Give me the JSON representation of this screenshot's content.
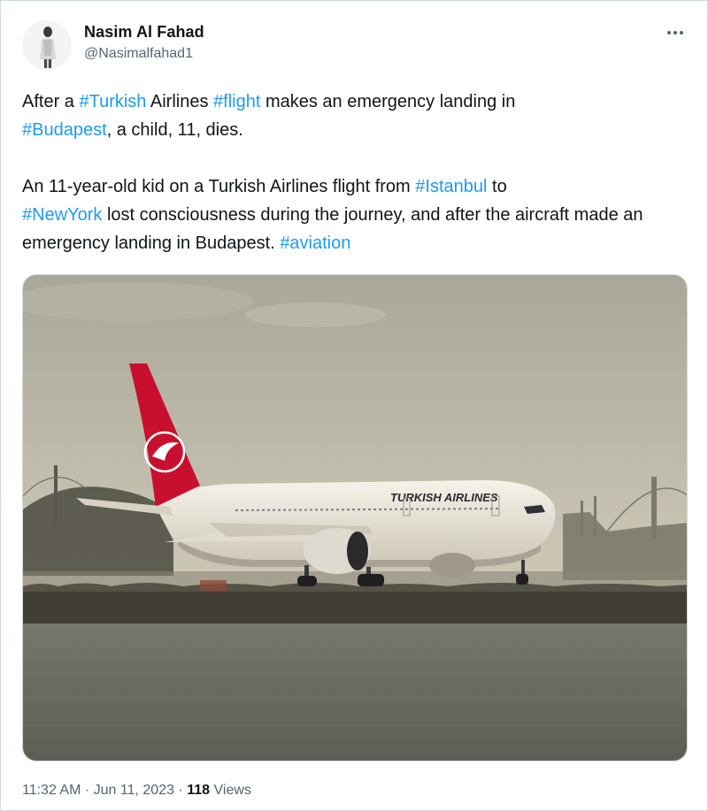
{
  "author": {
    "display_name": "Nasim Al Fahad",
    "handle": "@Nasimalfahad1"
  },
  "tweet": {
    "p1": {
      "t1": "After a ",
      "h1": "#Turkish",
      "t2": " Airlines ",
      "h2": "#flight",
      "t3": " makes an emergency landing in",
      "h3": "#Budapest",
      "t4": ", a child, 11, dies."
    },
    "p2": {
      "t1": "An 11-year-old kid on a Turkish Airlines flight from ",
      "h1": "#Istanbul",
      "t2": " to",
      "h2": "#NewYork",
      "t3": " lost consciousness during the journey, and after the aircraft made an emergency landing in Budapest. ",
      "h3": "#aviation"
    }
  },
  "media": {
    "airline_livery": "TURKISH AIRLINES"
  },
  "meta": {
    "time": "11:32 AM",
    "separator": "·",
    "date": "Jun 11, 2023",
    "views_count": "118",
    "views_label": "Views"
  },
  "icons": {
    "more": "more-dots-icon"
  },
  "colors": {
    "hashtag": "#1d9bf0",
    "secondary_text": "#536471",
    "primary_text": "#0f1419",
    "border": "#cfd9de"
  }
}
